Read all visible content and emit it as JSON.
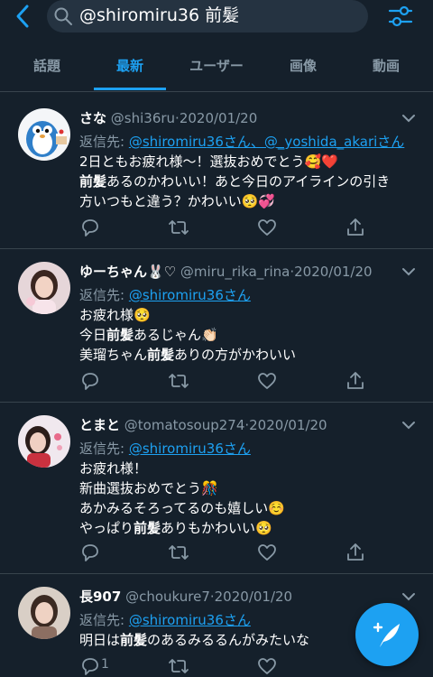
{
  "search": {
    "query": "@shiromiru36 前髪"
  },
  "tabs": [
    {
      "label": "話題"
    },
    {
      "label": "最新"
    },
    {
      "label": "ユーザー"
    },
    {
      "label": "画像"
    },
    {
      "label": "動画"
    }
  ],
  "tweets": [
    {
      "name": "さな",
      "handle": "@shi36ru",
      "date": "·2020/01/20",
      "reply_prefix": "返信先:",
      "reply_to": "@shiromiru36さん、@_yoshida_akariさん",
      "lines": [
        {
          "a": "2日ともお疲れ様〜！選抜おめでとう",
          "bold": "",
          "b": "🥰❤️"
        },
        {
          "a": "",
          "bold": "前髪",
          "b": "あるのかわいい！あと今日のアイラインの引き"
        },
        {
          "a": "方いつもと違う？かわいい🥺💞",
          "bold": "",
          "b": ""
        }
      ]
    },
    {
      "name": "ゆーちゃん🐰♡",
      "handle": "@miru_rika_rina",
      "date": "·2020/01/20",
      "reply_prefix": "返信先:",
      "reply_to": "@shiromiru36さん",
      "lines": [
        {
          "a": "お疲れ様🥺",
          "bold": "",
          "b": ""
        },
        {
          "a": "今日",
          "bold": "前髪",
          "b": "あるじゃん👏🏻"
        },
        {
          "a": "美瑠ちゃん",
          "bold": "前髪",
          "b": "ありの方がかわいい"
        }
      ]
    },
    {
      "name": "とまと",
      "handle": "@tomatosoup274",
      "date": "·2020/01/20",
      "reply_prefix": "返信先:",
      "reply_to": "@shiromiru36さん",
      "lines": [
        {
          "a": "お疲れ様！",
          "bold": "",
          "b": ""
        },
        {
          "a": "新曲選抜おめでとう🎊",
          "bold": "",
          "b": ""
        },
        {
          "a": "あかみるそろってるのも嬉しい☺️",
          "bold": "",
          "b": ""
        },
        {
          "a": "やっぱり",
          "bold": "前髪",
          "b": "ありもかわいい🥺"
        }
      ]
    },
    {
      "name": "長907",
      "handle": "@choukure7",
      "date": "·2020/01/20",
      "reply_prefix": "返信先:",
      "reply_to": "@shiromiru36さん",
      "lines": [
        {
          "a": "明日は",
          "bold": "前髪",
          "b": "のあるみるるんがみたいな"
        }
      ],
      "reply_count": "1"
    }
  ],
  "colors": {
    "background": "#15202b",
    "accent": "#1da1f2",
    "muted": "#8899a6",
    "divider": "#38444d"
  },
  "icons": [
    "back-arrow-icon",
    "search-icon",
    "filter-settings-icon",
    "chevron-down-icon",
    "reply-icon",
    "retweet-icon",
    "like-icon",
    "share-icon",
    "compose-tweet-icon"
  ]
}
